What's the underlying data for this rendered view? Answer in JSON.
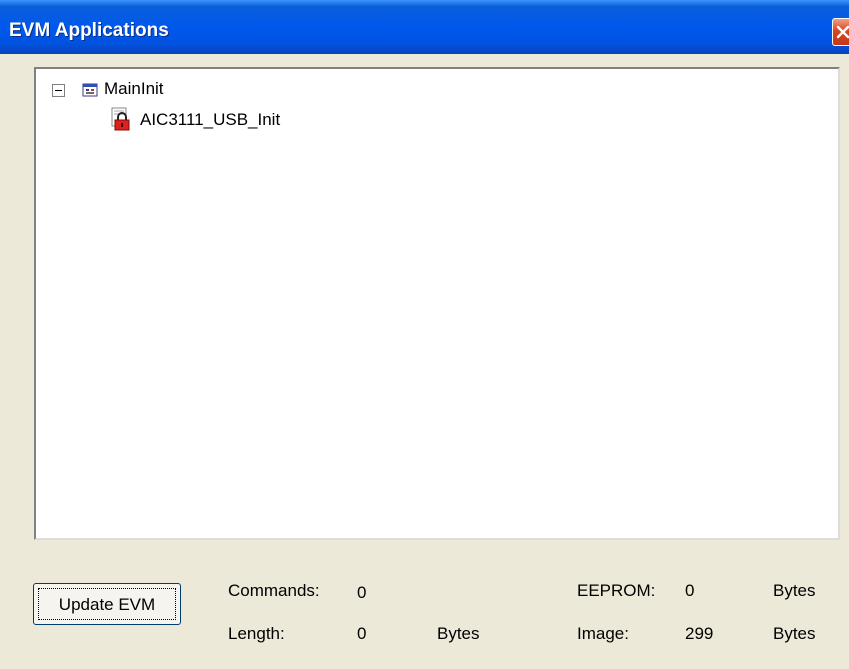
{
  "window": {
    "title": "EVM Applications"
  },
  "tree": {
    "root": {
      "label": "MainInit",
      "expanded": true,
      "icon": "application-icon"
    },
    "child": {
      "label": "AIC3111_USB_Init",
      "icon": "lock-icon"
    }
  },
  "footer": {
    "update_button": "Update EVM",
    "commands_label": "Commands:",
    "commands_value": "0",
    "length_label": "Length:",
    "length_value": "0",
    "length_unit": "Bytes",
    "eeprom_label": "EEPROM:",
    "eeprom_value": "0",
    "eeprom_unit": "Bytes",
    "image_label": "Image:",
    "image_value": "299",
    "image_unit": "Bytes"
  },
  "colors": {
    "titlebar": "#0058ee",
    "window_bg": "#ece9d8",
    "close": "#d6471f"
  }
}
